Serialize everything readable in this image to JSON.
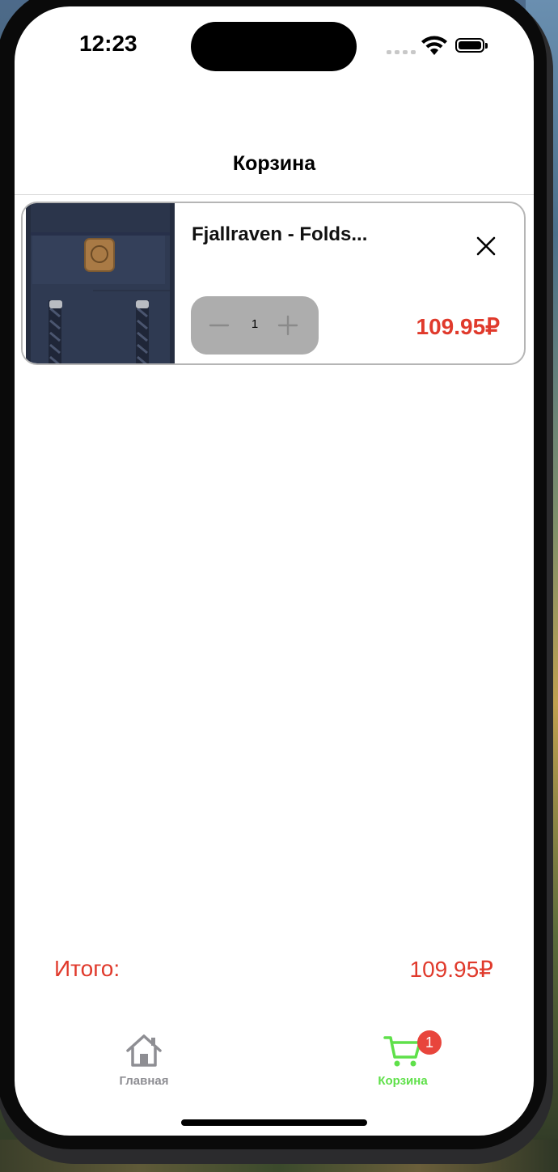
{
  "status_bar": {
    "time": "12:23"
  },
  "nav": {
    "title": "Корзина"
  },
  "cart": {
    "items": [
      {
        "name": "Fjallraven - Folds...",
        "quantity": "1",
        "price": "109.95₽",
        "image_icon": "backpack-image"
      }
    ]
  },
  "summary": {
    "label": "Итого:",
    "value": "109.95₽"
  },
  "tabs": [
    {
      "label": "Главная",
      "icon": "home-icon",
      "active": false
    },
    {
      "label": "Корзина",
      "icon": "cart-icon",
      "active": true,
      "badge": "1"
    }
  ],
  "colors": {
    "accent_price": "#e03a2c",
    "active_tab": "#5fe04a",
    "inactive_tab": "#8e8e93",
    "badge": "#e8453c",
    "stepper_bg": "#adadad"
  }
}
